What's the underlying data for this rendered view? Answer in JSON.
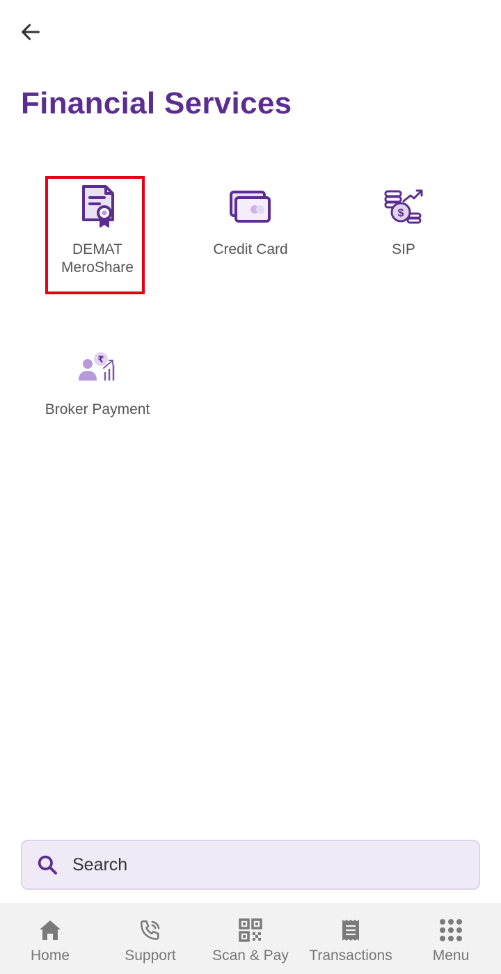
{
  "page": {
    "title": "Financial Services"
  },
  "colors": {
    "brand": "#5c2d91",
    "highlight": "#e60012",
    "nav_icon": "#7a7a7a"
  },
  "services": [
    {
      "label": "DEMAT\nMeroShare",
      "icon": "certificate-icon"
    },
    {
      "label": "Credit Card",
      "icon": "credit-card-icon"
    },
    {
      "label": "SIP",
      "icon": "coins-growth-icon"
    },
    {
      "label": "Broker Payment",
      "icon": "broker-payment-icon"
    }
  ],
  "search": {
    "placeholder": "Search"
  },
  "nav": [
    {
      "label": "Home",
      "icon": "home-icon"
    },
    {
      "label": "Support",
      "icon": "phone-icon"
    },
    {
      "label": "Scan & Pay",
      "icon": "qr-code-icon"
    },
    {
      "label": "Transactions",
      "icon": "receipt-icon"
    },
    {
      "label": "Menu",
      "icon": "grid-menu-icon"
    }
  ]
}
